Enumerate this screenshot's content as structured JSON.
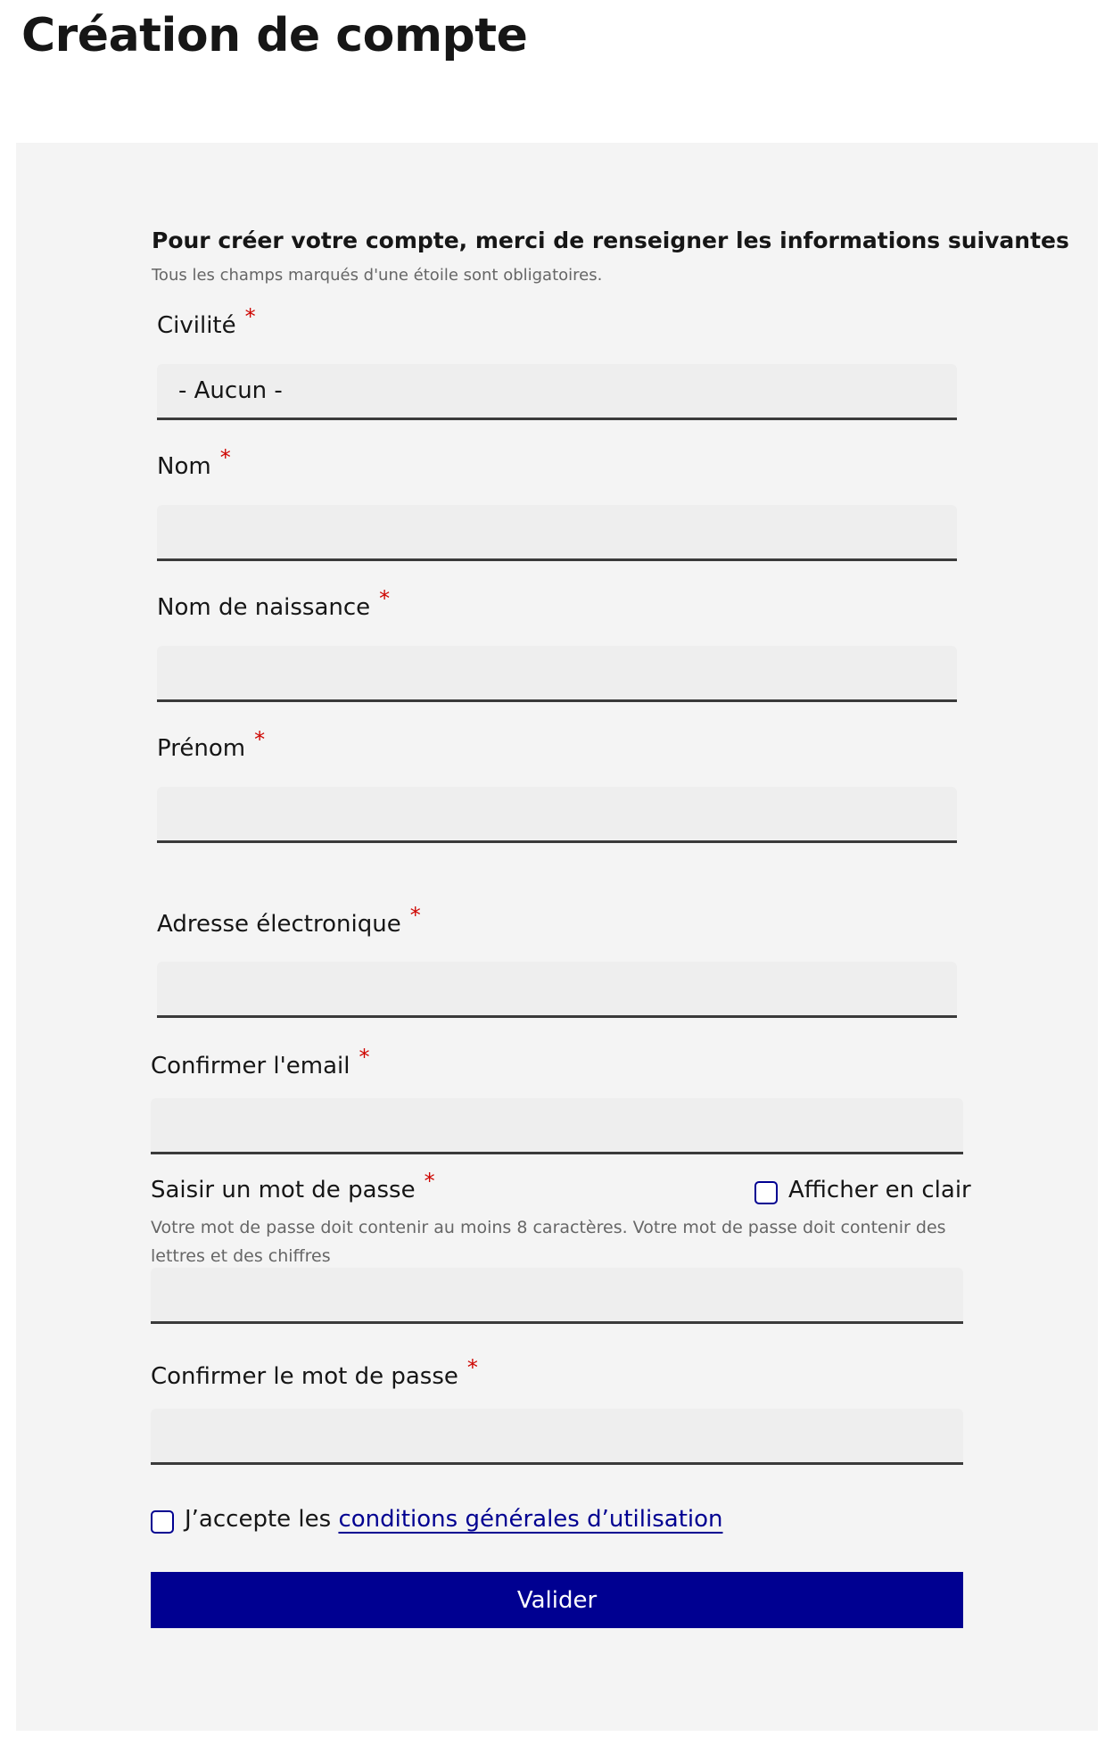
{
  "page": {
    "title": "Création de compte"
  },
  "form": {
    "intro_title": "Pour créer votre compte, merci de renseigner les informations suivantes",
    "intro_hint": "Tous les champs marqués d'une étoile sont obligatoires.",
    "required_marker": "*",
    "fields": {
      "civilite": {
        "label": "Civilité",
        "value": "- Aucun -"
      },
      "nom": {
        "label": "Nom",
        "value": ""
      },
      "nom_naissance": {
        "label": "Nom de naissance",
        "value": ""
      },
      "prenom": {
        "label": "Prénom",
        "value": ""
      },
      "email": {
        "label": "Adresse électronique",
        "value": ""
      },
      "email_confirm": {
        "label": "Confirmer l'email",
        "value": ""
      },
      "password": {
        "label": "Saisir un mot de passe",
        "hint": "Votre mot de passe doit contenir au moins 8 caractères. Votre mot de passe doit contenir des lettres et des chiffres",
        "show_label": "Afficher en clair",
        "show_checked": false,
        "value": ""
      },
      "password_confirm": {
        "label": "Confirmer le mot de passe",
        "value": ""
      }
    },
    "cgu": {
      "prefix": "J’accepte les ",
      "link_text": "conditions générales d’utilisation",
      "checked": false
    },
    "submit_label": "Valider"
  },
  "colors": {
    "primary": "#000091",
    "required": "#ce0500",
    "panel_bg": "#f4f4f4",
    "field_bg": "#eeeeee"
  }
}
